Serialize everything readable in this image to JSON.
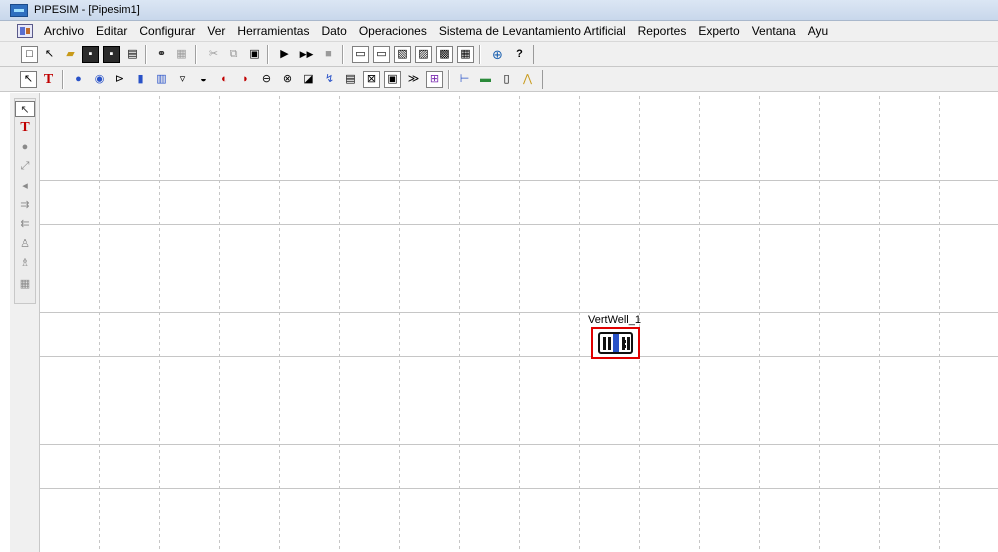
{
  "window": {
    "title": "PIPESIM - [Pipesim1]"
  },
  "menu": {
    "items": [
      "Archivo",
      "Editar",
      "Configurar",
      "Ver",
      "Herramientas",
      "Dato",
      "Operaciones",
      "Sistema de Levantamiento Artificial",
      "Reportes",
      "Experto",
      "Ventana",
      "Ayu"
    ]
  },
  "toolbar_standard": {
    "buttons": [
      {
        "icon": "new-file-icon",
        "glyph": "□"
      },
      {
        "icon": "connector-tool-icon",
        "glyph": "↖"
      },
      {
        "icon": "open-folder-icon",
        "glyph": "▰"
      },
      {
        "icon": "save-icon",
        "glyph": "▪"
      },
      {
        "icon": "save-as-icon",
        "glyph": "▪"
      },
      {
        "icon": "print-icon",
        "glyph": "▤"
      },
      {
        "icon": "find-icon",
        "glyph": "⚭"
      },
      {
        "icon": "find-next-icon",
        "glyph": "▦"
      },
      {
        "icon": "cut-icon",
        "glyph": "✂"
      },
      {
        "icon": "copy-icon",
        "glyph": "⧉"
      },
      {
        "icon": "paste-icon",
        "glyph": "▣"
      },
      {
        "icon": "run-icon",
        "glyph": "▶"
      },
      {
        "icon": "run-all-icon",
        "glyph": "▶▶"
      },
      {
        "icon": "stop-icon",
        "glyph": "■"
      },
      {
        "icon": "window-1-icon",
        "glyph": "▭"
      },
      {
        "icon": "window-2-icon",
        "glyph": "▭"
      },
      {
        "icon": "plot-icon",
        "glyph": "▧"
      },
      {
        "icon": "graph-icon",
        "glyph": "▨"
      },
      {
        "icon": "chart-icon",
        "glyph": "▩"
      },
      {
        "icon": "table-icon",
        "glyph": "▦"
      },
      {
        "icon": "globe-icon",
        "glyph": "⊕"
      },
      {
        "icon": "help-icon",
        "glyph": "?"
      }
    ]
  },
  "toolbar_objects": {
    "buttons": [
      {
        "icon": "select-pointer-icon",
        "glyph": "↖"
      },
      {
        "icon": "text-tool-icon",
        "glyph": "T"
      },
      {
        "icon": "source-icon",
        "glyph": "●"
      },
      {
        "icon": "sink-icon",
        "glyph": "◉"
      },
      {
        "icon": "injection-point-icon",
        "glyph": "⊳"
      },
      {
        "icon": "well-icon",
        "glyph": "▮"
      },
      {
        "icon": "riser-icon",
        "glyph": "▥"
      },
      {
        "icon": "choke-icon",
        "glyph": "▿"
      },
      {
        "icon": "compressor-icon",
        "glyph": "◒"
      },
      {
        "icon": "pump-icon",
        "glyph": "◐"
      },
      {
        "icon": "separator-icon",
        "glyph": "◗"
      },
      {
        "icon": "heat-exchanger-icon",
        "glyph": "⊖"
      },
      {
        "icon": "multiplier-icon",
        "glyph": "⊗"
      },
      {
        "icon": "expander-icon",
        "glyph": "◪"
      },
      {
        "icon": "junction-icon",
        "glyph": "↯"
      },
      {
        "icon": "report-tool-icon",
        "glyph": "▤"
      },
      {
        "icon": "completion-icon",
        "glyph": "⊠"
      },
      {
        "icon": "flowline-icon",
        "glyph": "▣"
      },
      {
        "icon": "tie-in-icon",
        "glyph": "≫"
      },
      {
        "icon": "multiphase-booster-icon",
        "glyph": "⊞"
      },
      {
        "icon": "horizontal-completion-icon",
        "glyph": "⊢"
      },
      {
        "icon": "tubing-icon",
        "glyph": "▬"
      },
      {
        "icon": "packer-icon",
        "glyph": "▯"
      },
      {
        "icon": "nodal-analysis-icon",
        "glyph": "⋀"
      }
    ]
  },
  "palette": {
    "buttons": [
      {
        "icon": "select-pointer-icon",
        "glyph": "↖"
      },
      {
        "icon": "text-tool-icon",
        "glyph": "T"
      },
      {
        "icon": "source-icon",
        "glyph": "●"
      },
      {
        "icon": "connector-icon",
        "glyph": "⤢"
      },
      {
        "icon": "sink-icon",
        "glyph": "◂"
      },
      {
        "icon": "injection-icon",
        "glyph": "⇉"
      },
      {
        "icon": "production-well-icon",
        "glyph": "⇇"
      },
      {
        "icon": "person-icon",
        "glyph": "♙"
      },
      {
        "icon": "user-tool-icon",
        "glyph": "♗"
      },
      {
        "icon": "grid-icon",
        "glyph": "▦"
      }
    ]
  },
  "canvas": {
    "well_label": "VertWell_1"
  },
  "colors": {
    "selection_border": "#e00000",
    "well_core": "#2952c8"
  }
}
